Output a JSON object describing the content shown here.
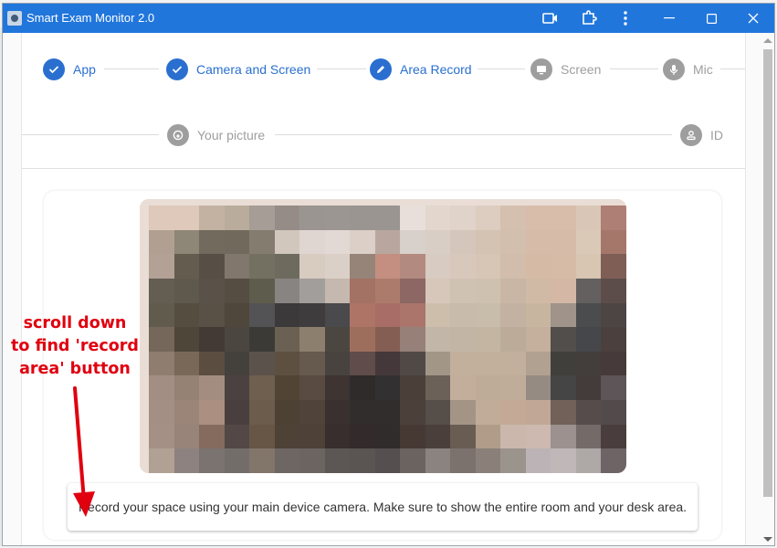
{
  "window": {
    "title": "Smart Exam Monitor 2.0",
    "controls": [
      "camera-icon",
      "extension-icon",
      "more-icon",
      "minimize",
      "maximize",
      "close"
    ]
  },
  "stepper": {
    "row1": [
      {
        "label": "App",
        "state": "done",
        "icon": "check-icon"
      },
      {
        "label": "Camera and Screen",
        "state": "done",
        "icon": "check-icon"
      },
      {
        "label": "Area Record",
        "state": "active",
        "icon": "pencil-icon"
      },
      {
        "label": "Screen",
        "state": "pending",
        "icon": "monitor-icon"
      },
      {
        "label": "Mic",
        "state": "pending",
        "icon": "mic-icon"
      }
    ],
    "row2": [
      {
        "label": "Your picture",
        "state": "pending",
        "icon": "face-icon"
      },
      {
        "label": "ID",
        "state": "pending",
        "icon": "person-badge-icon"
      }
    ]
  },
  "camera_preview": {
    "description": "pixelated live camera preview",
    "mosaic_colors": [
      [
        "#dfc9bb",
        "#dfc9bb",
        "#c3b2a2",
        "#baac9c",
        "#a59d96",
        "#958c88",
        "#9a9590",
        "#9c9692",
        "#9a9591",
        "#9a9591",
        "#e9dfda",
        "#e2d6cd",
        "#e0d3c9",
        "#dccdc0",
        "#d5c0b0",
        "#d8bdab",
        "#d8bdab",
        "#d9c6b6",
        "#ae7f74"
      ],
      [
        "#b1a091",
        "#8e8676",
        "#716a5d",
        "#716a5c",
        "#837c6f",
        "#d1c7bc",
        "#e0d6d1",
        "#e3d9d4",
        "#dbcfc7",
        "#b9a79f",
        "#d8d0ca",
        "#d8cec5",
        "#d5c6bb",
        "#d4c2b2",
        "#d3bfae",
        "#d6bba8",
        "#d6bba8",
        "#dbc9b8",
        "#a5776b"
      ],
      [
        "#b3a195",
        "#645d4f",
        "#574f45",
        "#81776d",
        "#737062",
        "#6d6a5e",
        "#d8cbc0",
        "#dbd0c7",
        "#968479",
        "#c48f80",
        "#b38a80",
        "#d7cbc2",
        "#d8c8bc",
        "#d7c5b5",
        "#d2bcab",
        "#d5bba6",
        "#d6bba7",
        "#d8c5b2",
        "#7e5e55"
      ],
      [
        "#645d52",
        "#5f594d",
        "#5a5148",
        "#554c42",
        "#5e5c4c",
        "#878482",
        "#a29e9b",
        "#c5b8ae",
        "#a37265",
        "#ad7b6c",
        "#8c6763",
        "#d6c7ba",
        "#d0c2b2",
        "#cfc1af",
        "#c9b6a5",
        "#d0b9a5",
        "#d4b8a5",
        "#646060",
        "#5d4d4a"
      ],
      [
        "#615b4e",
        "#554d40",
        "#595145",
        "#4f463c",
        "#535356",
        "#3b393a",
        "#3f3c3d",
        "#4a494c",
        "#ae7465",
        "#a76d66",
        "#ab756c",
        "#cdbeac",
        "#c9bbab",
        "#c8bcab",
        "#c3b2a1",
        "#c8b5a0",
        "#9f938a",
        "#4b4c4e",
        "#4d4544"
      ],
      [
        "#756759",
        "#4e4639",
        "#433a35",
        "#4b4640",
        "#3b3a37",
        "#6b6153",
        "#8c7f6e",
        "#4c4640",
        "#9e6e5d",
        "#845e53",
        "#968078",
        "#c2b6a8",
        "#c2b5a6",
        "#c3b5a2",
        "#bcab99",
        "#c4b09c",
        "#524e4b",
        "#46474a",
        "#4c403f"
      ],
      [
        "#8f7d70",
        "#796858",
        "#5b4e41",
        "#44403c",
        "#5c524c",
        "#5d5041",
        "#66594e",
        "#48433f",
        "#5f4c4b",
        "#44383a",
        "#514945",
        "#a29787",
        "#c2b09d",
        "#c2b09d",
        "#c3b09c",
        "#b1a190",
        "#403f3c",
        "#433e3c",
        "#463b3a"
      ],
      [
        "#a38e83",
        "#968274",
        "#a28d80",
        "#4b4140",
        "#6f5f4e",
        "#514434",
        "#594b41",
        "#3e3431",
        "#302b2b",
        "#333032",
        "#4b3f3a",
        "#6b6158",
        "#c2ae9a",
        "#bfac98",
        "#c0ad99",
        "#968b83",
        "#454546",
        "#443c3b",
        "#5e5558"
      ],
      [
        "#a48f85",
        "#9a8578",
        "#ab8f81",
        "#493f3e",
        "#6c5c4c",
        "#4d4134",
        "#4f433a",
        "#3a302f",
        "#312d2c",
        "#312d2d",
        "#4b403a",
        "#564e48",
        "#a39485",
        "#c0ac99",
        "#c3a996",
        "#c1a796",
        "#726159",
        "#564c4c",
        "#524a4b"
      ],
      [
        "#a59086",
        "#988478",
        "#846b5e",
        "#534846",
        "#675646",
        "#4e4136",
        "#4e4137",
        "#382e2d",
        "#332b2b",
        "#312c2c",
        "#463933",
        "#4a3f3a",
        "#695d53",
        "#b09c88",
        "#ccb7ac",
        "#cdb9af",
        "#9c918e",
        "#746a67",
        "#493e3d"
      ],
      [
        "#b0a194",
        "#8d8280",
        "#7a7370",
        "#736d6a",
        "#827569",
        "#6e6663",
        "#6c6461",
        "#5c5654",
        "#5a5452",
        "#554f4f",
        "#6b6360",
        "#8a8380",
        "#7c726d",
        "#8b8079",
        "#9b948d",
        "#bbb3b5",
        "#bfb7b8",
        "#aea8a7",
        "#6e6466"
      ]
    ]
  },
  "instructions": {
    "text": "Record your space using your main device camera. Make sure to show the entire room and your desk area."
  },
  "annotation": {
    "lines": [
      "scroll down",
      "to find 'record",
      "area' button"
    ],
    "color": "#e00010"
  },
  "colors": {
    "titlebar": "#2176dc",
    "accent": "#2a6fd0",
    "pending": "#9e9e9e"
  }
}
